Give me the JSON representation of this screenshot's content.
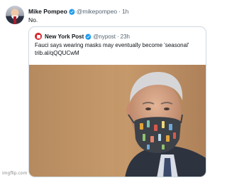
{
  "tweet": {
    "author_name": "Mike Pompeo",
    "author_handle": "@mikepompeo",
    "separator": "·",
    "time": "1h",
    "text": "No.",
    "avatar_icon": "profile-photo",
    "verified_icon": "verified-badge-icon"
  },
  "quote": {
    "author_name": "New York Post",
    "author_handle": "@nypost",
    "separator": "·",
    "time": "23h",
    "text_line1": "Fauci says wearing masks may eventually become 'seasonal'",
    "text_line2": "trib.al/qQQUCwM",
    "logo_icon": "nypost-logo-icon",
    "image_icon": "man-wearing-mask-photo"
  },
  "watermark": "imgflip.com",
  "colors": {
    "verified": "#1d9bf0",
    "nypost_red": "#d8232a",
    "secondary_text": "#536471",
    "border": "#cfd9de"
  }
}
